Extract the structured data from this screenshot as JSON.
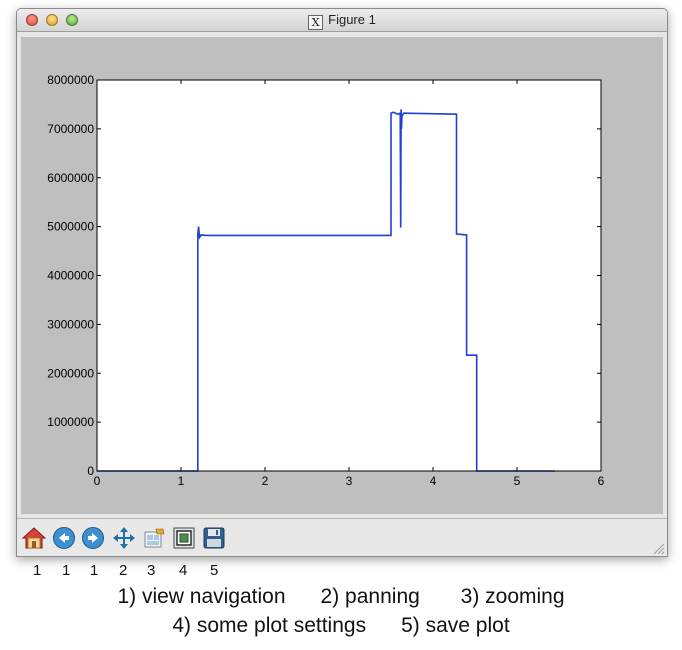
{
  "window": {
    "title": "Figure 1",
    "title_icon": "x11-icon"
  },
  "chart_data": {
    "type": "line",
    "xlim": [
      0,
      6
    ],
    "ylim": [
      0,
      8000000
    ],
    "xticks": [
      "0",
      "1",
      "2",
      "3",
      "4",
      "5",
      "6"
    ],
    "yticks": [
      "0",
      "1000000",
      "2000000",
      "3000000",
      "4000000",
      "5000000",
      "6000000",
      "7000000",
      "8000000"
    ],
    "grid": false,
    "line_color": "#1f3fd6",
    "series": [
      {
        "x": [
          0,
          1.2,
          1.2,
          1.21,
          1.22,
          1.24,
          1.3,
          3.5,
          3.5,
          3.53,
          3.58,
          3.61,
          3.615,
          3.62,
          3.625,
          3.63,
          3.65,
          3.67,
          4.28,
          4.28,
          4.4,
          4.4,
          4.52,
          4.52,
          5.45
        ],
        "y": [
          0,
          0,
          4850000,
          5000000,
          4780000,
          4830000,
          4820000,
          4820000,
          7320000,
          7340000,
          7300000,
          7320000,
          4980000,
          7400000,
          7000000,
          7250000,
          7320000,
          7320000,
          7300000,
          4850000,
          4830000,
          2370000,
          2370000,
          0,
          0
        ]
      }
    ]
  },
  "toolbar": {
    "buttons": [
      {
        "name": "home-button",
        "icon": "home-icon"
      },
      {
        "name": "back-button",
        "icon": "back-arrow-icon"
      },
      {
        "name": "forward-button",
        "icon": "forward-arrow-icon"
      },
      {
        "name": "pan-button",
        "icon": "move-icon"
      },
      {
        "name": "configure-subplots-button",
        "icon": "subplots-icon"
      },
      {
        "name": "zoom-button",
        "icon": "zoom-rect-icon"
      },
      {
        "name": "save-button",
        "icon": "floppy-disk-icon"
      }
    ]
  },
  "annotations": {
    "numbers": [
      "1",
      "1",
      "1",
      "2",
      "3",
      "4",
      "5"
    ],
    "caption_line1": "1) view navigation      2) panning       3) zooming",
    "caption_line2": "4) some plot settings      5) save plot"
  }
}
